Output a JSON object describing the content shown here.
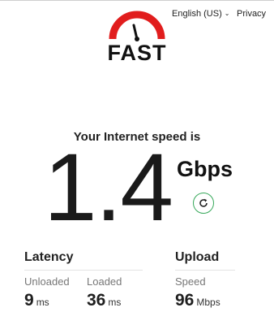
{
  "header": {
    "logo_text": "FAST",
    "language": "English (US)",
    "privacy_label": "Privacy"
  },
  "speed": {
    "heading": "Your Internet speed is",
    "value": "1.4",
    "units": "Gbps"
  },
  "latency": {
    "title": "Latency",
    "unloaded_label": "Unloaded",
    "unloaded_value": "9",
    "unloaded_unit": "ms",
    "loaded_label": "Loaded",
    "loaded_value": "36",
    "loaded_unit": "ms"
  },
  "upload": {
    "title": "Upload",
    "speed_label": "Speed",
    "speed_value": "96",
    "speed_unit": "Mbps"
  },
  "icons": {
    "logo": "speedometer-gauge-icon",
    "language_dropdown": "chevron-down-icon",
    "refresh": "refresh-icon"
  },
  "colors": {
    "brand_red": "#e11d1d",
    "refresh_green": "#37a85a",
    "text": "#222222",
    "muted": "#777777"
  }
}
